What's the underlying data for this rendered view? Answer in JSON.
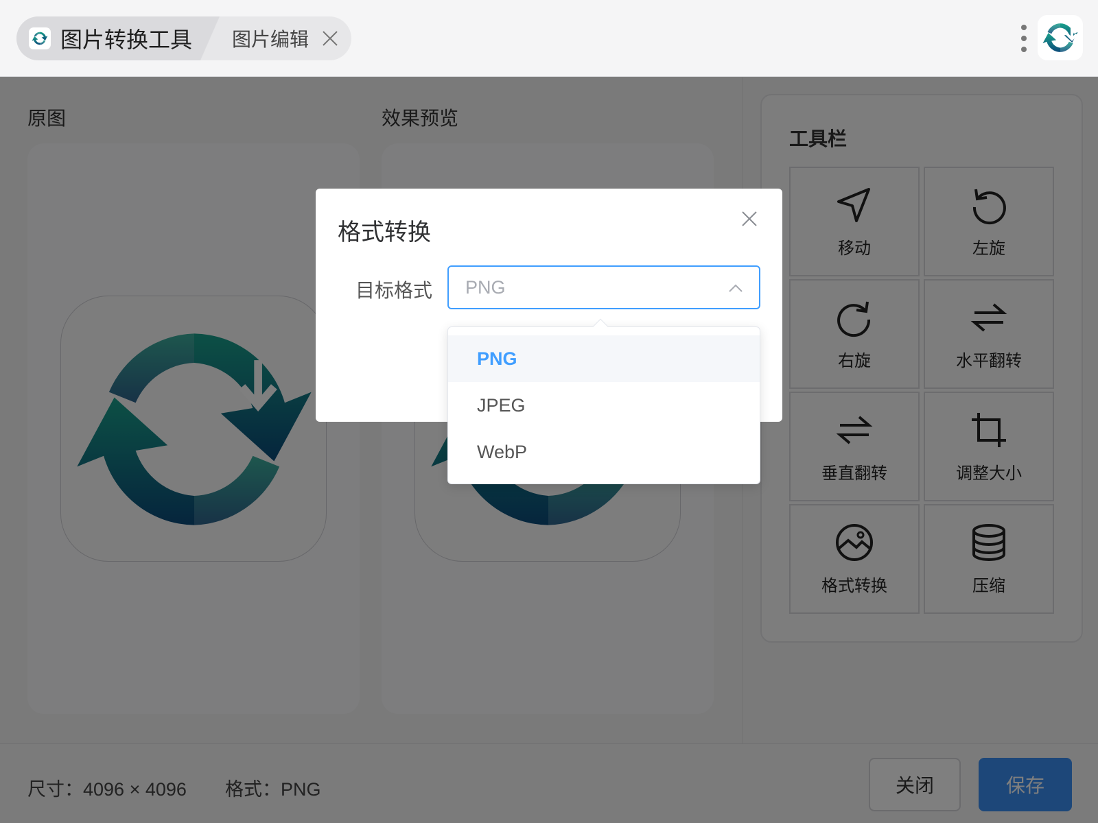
{
  "titlebar": {
    "tabs": [
      {
        "label": "图片转换工具",
        "active": true
      },
      {
        "label": "图片编辑",
        "active": false
      }
    ]
  },
  "main": {
    "original_label": "原图",
    "preview_label": "效果预览"
  },
  "toolbar": {
    "title": "工具栏",
    "tools": [
      {
        "label": "移动",
        "icon": "navigation-arrow-icon"
      },
      {
        "label": "左旋",
        "icon": "rotate-left-icon"
      },
      {
        "label": "右旋",
        "icon": "rotate-right-icon"
      },
      {
        "label": "水平翻转",
        "icon": "flip-horizontal-icon"
      },
      {
        "label": "垂直翻转",
        "icon": "flip-vertical-icon"
      },
      {
        "label": "调整大小",
        "icon": "crop-icon"
      },
      {
        "label": "格式转换",
        "icon": "image-circle-icon"
      },
      {
        "label": "压缩",
        "icon": "coins-stack-icon"
      }
    ]
  },
  "footer": {
    "size_text": "尺寸：4096 × 4096",
    "format_text": "格式：PNG",
    "close_label": "关闭",
    "save_label": "保存"
  },
  "dialog": {
    "title": "格式转换",
    "field_label": "目标格式",
    "selected_value": "PNG",
    "options": [
      "PNG",
      "JPEG",
      "WebP"
    ]
  },
  "colors": {
    "accent": "#409eff",
    "save_button": "#3a8ef2",
    "logo_teal": "#1a9e8a",
    "logo_blue": "#0b4a7a"
  }
}
